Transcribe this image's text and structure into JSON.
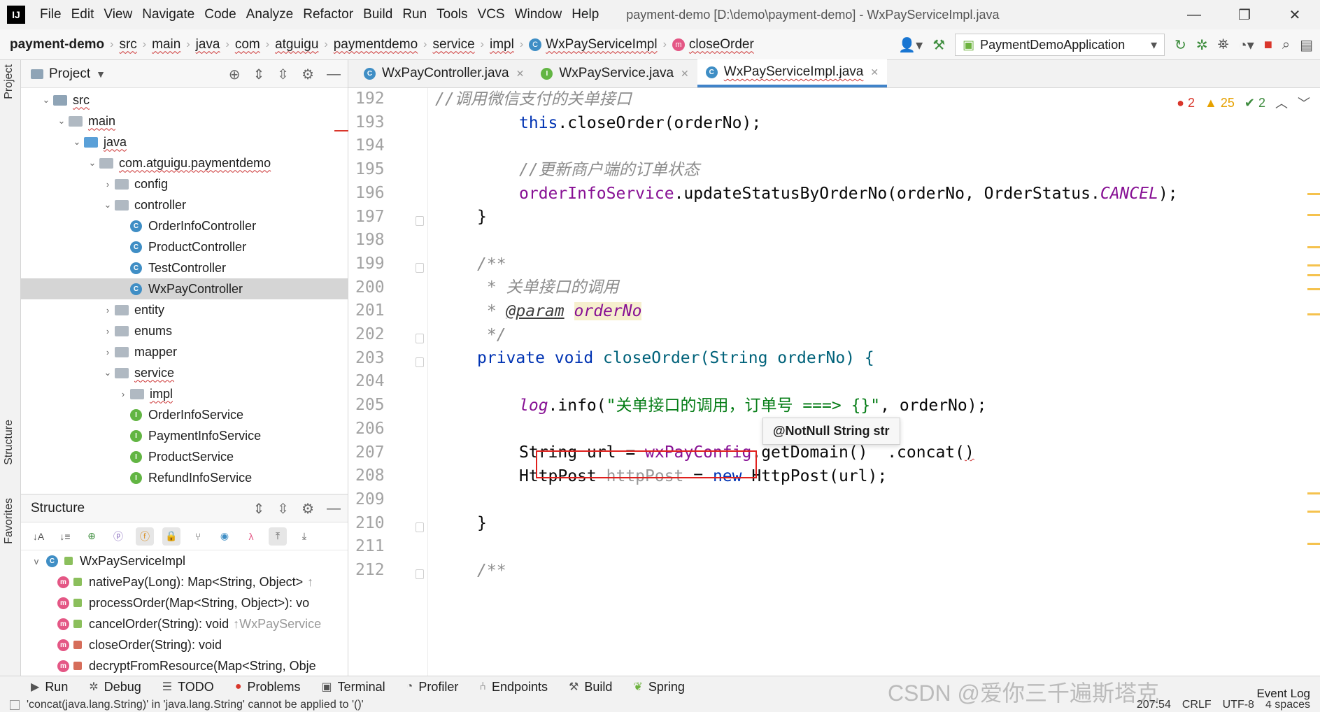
{
  "menubar": {
    "logo": "IJ",
    "items": [
      "File",
      "Edit",
      "View",
      "Navigate",
      "Code",
      "Analyze",
      "Refactor",
      "Build",
      "Run",
      "Tools",
      "VCS",
      "Window",
      "Help"
    ],
    "window_title": "payment-demo [D:\\demo\\payment-demo] - WxPayServiceImpl.java",
    "controls": [
      "—",
      "❐",
      "✕"
    ]
  },
  "navbar": {
    "crumbs": [
      "payment-demo",
      "src",
      "main",
      "java",
      "com",
      "atguigu",
      "paymentdemo",
      "service",
      "impl",
      "WxPayServiceImpl",
      "closeOrder"
    ],
    "run_config": "PaymentDemoApplication"
  },
  "left_strip": {
    "project": "Project",
    "structure": "Structure",
    "favorites": "Favorites"
  },
  "project_panel": {
    "title": "Project",
    "tree": [
      {
        "label": "src",
        "indent": 1,
        "chev": "v",
        "kind": "src"
      },
      {
        "label": "main",
        "indent": 2,
        "chev": "v",
        "kind": "folder"
      },
      {
        "label": "java",
        "indent": 3,
        "chev": "v",
        "kind": "java"
      },
      {
        "label": "com.atguigu.paymentdemo",
        "indent": 4,
        "chev": "v",
        "kind": "pkg"
      },
      {
        "label": "config",
        "indent": 5,
        "chev": ">",
        "kind": "pkg"
      },
      {
        "label": "controller",
        "indent": 5,
        "chev": "v",
        "kind": "pkg"
      },
      {
        "label": "OrderInfoController",
        "indent": 6,
        "kind": "class"
      },
      {
        "label": "ProductController",
        "indent": 6,
        "kind": "class"
      },
      {
        "label": "TestController",
        "indent": 6,
        "kind": "class"
      },
      {
        "label": "WxPayController",
        "indent": 6,
        "kind": "class",
        "selected": true
      },
      {
        "label": "entity",
        "indent": 5,
        "chev": ">",
        "kind": "pkg"
      },
      {
        "label": "enums",
        "indent": 5,
        "chev": ">",
        "kind": "pkg"
      },
      {
        "label": "mapper",
        "indent": 5,
        "chev": ">",
        "kind": "pkg"
      },
      {
        "label": "service",
        "indent": 5,
        "chev": "v",
        "kind": "pkg"
      },
      {
        "label": "impl",
        "indent": 6,
        "chev": ">",
        "kind": "pkg"
      },
      {
        "label": "OrderInfoService",
        "indent": 6,
        "kind": "interface"
      },
      {
        "label": "PaymentInfoService",
        "indent": 6,
        "kind": "interface"
      },
      {
        "label": "ProductService",
        "indent": 6,
        "kind": "interface"
      },
      {
        "label": "RefundInfoService",
        "indent": 6,
        "kind": "interface"
      }
    ]
  },
  "structure_panel": {
    "title": "Structure",
    "root": "WxPayServiceImpl",
    "members": [
      {
        "sig": "nativePay(Long): Map<String, Object>",
        "hint": "↑",
        "vis": "pub"
      },
      {
        "sig": "processOrder(Map<String, Object>): vo",
        "hint": "",
        "vis": "pub"
      },
      {
        "sig": "cancelOrder(String): void",
        "hint": "↑WxPayService",
        "vis": "pub"
      },
      {
        "sig": "closeOrder(String): void",
        "hint": "",
        "vis": "priv"
      },
      {
        "sig": "decryptFromResource(Map<String, Obje",
        "hint": "",
        "vis": "priv"
      }
    ]
  },
  "editor": {
    "tabs": [
      {
        "label": "WxPayController.java",
        "active": false
      },
      {
        "label": "WxPayService.java",
        "active": false,
        "iface": true
      },
      {
        "label": "WxPayServiceImpl.java",
        "active": true
      }
    ],
    "inspections": {
      "errors": "2",
      "warnings": "25",
      "weak": "2"
    },
    "line_numbers": [
      "192",
      "193",
      "194",
      "195",
      "196",
      "197",
      "198",
      "199",
      "200",
      "201",
      "202",
      "203",
      "204",
      "205",
      "206",
      "207",
      "208",
      "209",
      "210",
      "211",
      "212"
    ],
    "code": {
      "l192": "//调用微信支付的关单接口",
      "l193_this": "this",
      "l193_rest": ".closeOrder(orderNo);",
      "l195": "//更新商户端的订单状态",
      "l196_field": "orderInfoService",
      "l196_mid": ".updateStatusByOrderNo(orderNo, OrderStatus.",
      "l196_static": "CANCEL",
      "l196_end": ");",
      "l197": "}",
      "l199": "/**",
      "l200": " * 关单接口的调用",
      "l201_star": " * ",
      "l201_tag": "@param",
      "l201_param": "orderNo",
      "l202": " */",
      "l203_kw1": "private",
      "l203_kw2": "void",
      "l203_rest": " closeOrder(String orderNo) {",
      "l205_log": "log",
      "l205_mid": ".info(",
      "l205_str": "\"关单接口的调用，订单号 ===> {}\"",
      "l205_end": ", orderNo);",
      "l207_a": "String url = ",
      "l207_field": "wxPayConfig",
      "l207_b": ".getDomain()  .concat(",
      "l207_caret": ")",
      "l208_a": "HttpPost ",
      "l208_var": "httpPost",
      "l208_b": " = ",
      "l208_new": "new",
      "l208_c": " HttpPost(url);",
      "l210": "}",
      "l212": "/**"
    },
    "tooltip": "@NotNull String str"
  },
  "bottom": {
    "tool_tabs": [
      "Run",
      "Debug",
      "TODO",
      "Problems",
      "Terminal",
      "Profiler",
      "Endpoints",
      "Build",
      "Spring"
    ],
    "status_message": "'concat(java.lang.String)' in 'java.lang.String' cannot be applied to '()'",
    "status_right": [
      "207:54",
      "CRLF",
      "UTF-8",
      "4 spaces"
    ],
    "event_log": "Event Log",
    "watermark": "CSDN @爱你三千遍斯塔克"
  }
}
